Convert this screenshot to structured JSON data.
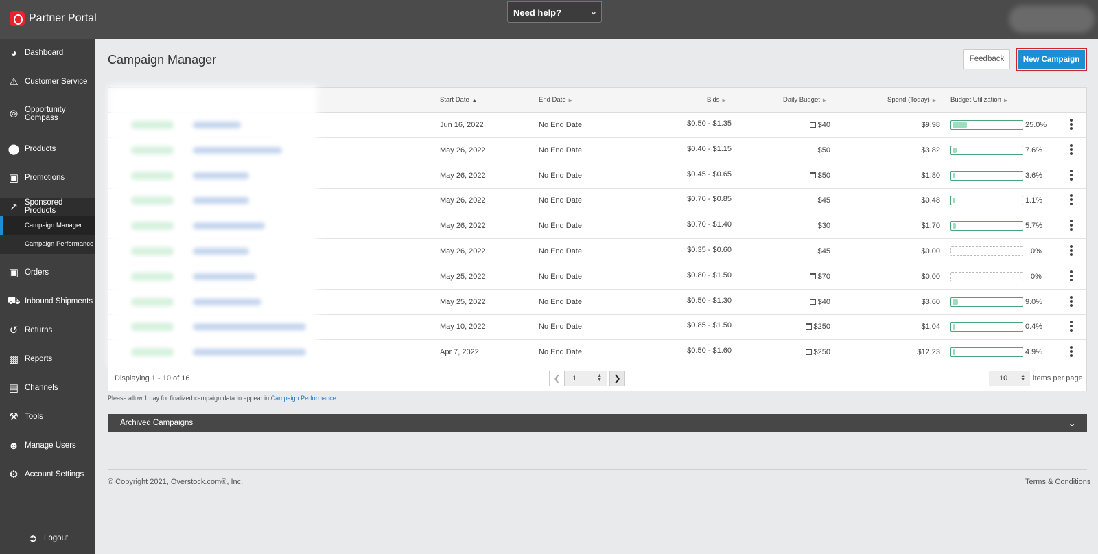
{
  "app": {
    "title": "Partner Portal",
    "help_label": "Need help?",
    "accent": "#1a8fd6",
    "brand_color": "#e8212a"
  },
  "sidebar": {
    "items": [
      {
        "label": "Dashboard",
        "icon": "dashboard-gauge-icon"
      },
      {
        "label": "Customer Service",
        "icon": "warning-icon"
      },
      {
        "label": "Opportunity Compass",
        "icon": "compass-icon"
      },
      {
        "label": "Products",
        "icon": "tag-icon"
      },
      {
        "label": "Promotions",
        "icon": "money-icon"
      },
      {
        "label": "Sponsored Products",
        "icon": "line-chart-icon"
      },
      {
        "label": "Orders",
        "icon": "inbox-icon"
      },
      {
        "label": "Inbound Shipments",
        "icon": "truck-icon"
      },
      {
        "label": "Returns",
        "icon": "returns-icon"
      },
      {
        "label": "Reports",
        "icon": "bar-chart-icon"
      },
      {
        "label": "Channels",
        "icon": "monitor-icon"
      },
      {
        "label": "Tools",
        "icon": "wrench-icon"
      },
      {
        "label": "Manage Users",
        "icon": "users-icon"
      },
      {
        "label": "Account Settings",
        "icon": "gear-icon"
      }
    ],
    "sub_items": [
      {
        "label": "Campaign Manager",
        "active": true
      },
      {
        "label": "Campaign Performance",
        "active": false
      }
    ],
    "logout_label": "Logout"
  },
  "main": {
    "title": "Campaign Manager",
    "feedback_label": "Feedback",
    "new_campaign_label": "New Campaign",
    "columns": [
      "Start Date",
      "End Date",
      "Bids",
      "Daily Budget",
      "Spend (Today)",
      "Budget Utilization"
    ],
    "rows": [
      {
        "start": "Jun 16, 2022",
        "end": "No End Date",
        "bids": "$0.50 - $1.35",
        "budget": "$40",
        "scheduled": true,
        "spend": "$9.98",
        "util": "25.0%",
        "util_value": 25.0
      },
      {
        "start": "May 26, 2022",
        "end": "No End Date",
        "bids": "$0.40 - $1.15",
        "budget": "$50",
        "scheduled": false,
        "spend": "$3.82",
        "util": "7.6%",
        "util_value": 7.6
      },
      {
        "start": "May 26, 2022",
        "end": "No End Date",
        "bids": "$0.45 - $0.65",
        "budget": "$50",
        "scheduled": true,
        "spend": "$1.80",
        "util": "3.6%",
        "util_value": 3.6
      },
      {
        "start": "May 26, 2022",
        "end": "No End Date",
        "bids": "$0.70 - $0.85",
        "budget": "$45",
        "scheduled": false,
        "spend": "$0.48",
        "util": "1.1%",
        "util_value": 1.1
      },
      {
        "start": "May 26, 2022",
        "end": "No End Date",
        "bids": "$0.70 - $1.40",
        "budget": "$30",
        "scheduled": false,
        "spend": "$1.70",
        "util": "5.7%",
        "util_value": 5.7
      },
      {
        "start": "May 26, 2022",
        "end": "No End Date",
        "bids": "$0.35 - $0.60",
        "budget": "$45",
        "scheduled": false,
        "spend": "$0.00",
        "util": "0%",
        "util_value": 0
      },
      {
        "start": "May 25, 2022",
        "end": "No End Date",
        "bids": "$0.80 - $1.50",
        "budget": "$70",
        "scheduled": true,
        "spend": "$0.00",
        "util": "0%",
        "util_value": 0
      },
      {
        "start": "May 25, 2022",
        "end": "No End Date",
        "bids": "$0.50 - $1.30",
        "budget": "$40",
        "scheduled": true,
        "spend": "$3.60",
        "util": "9.0%",
        "util_value": 9.0
      },
      {
        "start": "May 10, 2022",
        "end": "No End Date",
        "bids": "$0.85 - $1.50",
        "budget": "$250",
        "scheduled": true,
        "spend": "$1.04",
        "util": "0.4%",
        "util_value": 0.4
      },
      {
        "start": "Apr 7, 2022",
        "end": "No End Date",
        "bids": "$0.50 - $1.60",
        "budget": "$250",
        "scheduled": true,
        "spend": "$12.23",
        "util": "4.9%",
        "util_value": 4.9
      }
    ],
    "pagination": {
      "displaying": "Displaying 1 - 10 of 16",
      "page": "1",
      "per_page": "10",
      "per_page_label": "items per page"
    },
    "note_text": "Please allow 1 day for finalized campaign data to appear in ",
    "note_link": "Campaign Performance",
    "note_end": ".",
    "archived_label": "Archived Campaigns"
  },
  "footer": {
    "copyright": "© Copyright 2021, Overstock.com®, Inc.",
    "terms": "Terms & Conditions"
  }
}
